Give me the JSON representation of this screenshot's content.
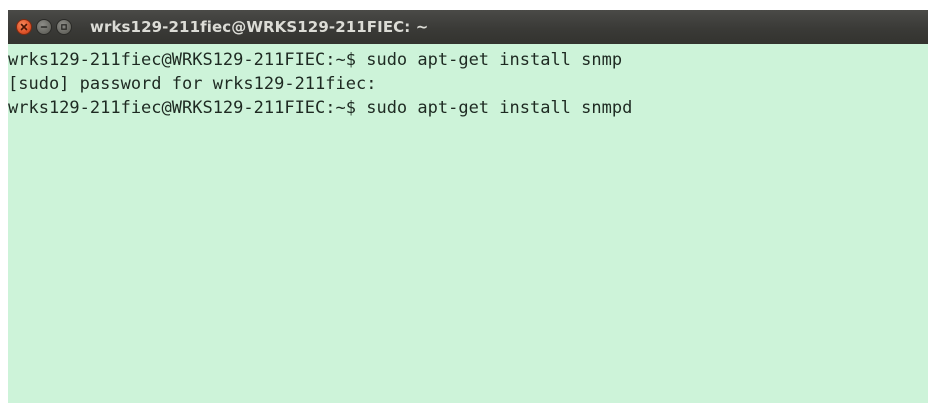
{
  "window": {
    "title": "wrks129-211fiec@WRKS129-211FIEC: ~",
    "controls": [
      "close-icon",
      "minimize-icon",
      "maximize-icon"
    ]
  },
  "terminal": {
    "background": "#cdf3d9",
    "lines": [
      "wrks129-211fiec@WRKS129-211FIEC:~$ sudo apt-get install snmp",
      "[sudo] password for wrks129-211fiec:",
      "wrks129-211fiec@WRKS129-211FIEC:~$ sudo apt-get install snmpd"
    ]
  }
}
